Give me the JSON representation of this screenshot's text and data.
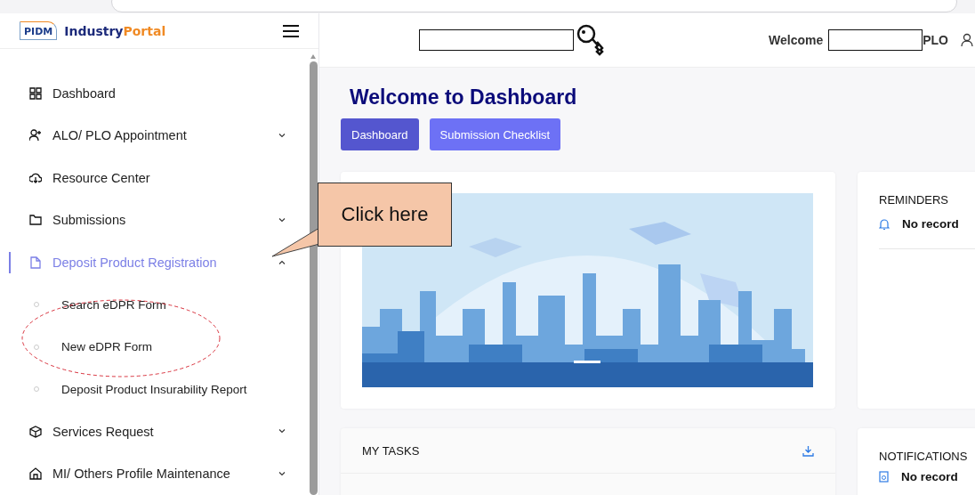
{
  "header": {
    "logo_mark": "PIDM",
    "logo_name_first": "Industry",
    "logo_name_second": "Portal",
    "welcome": "Welcome",
    "role": "PLO"
  },
  "sidebar": {
    "items": [
      {
        "kind": "grid",
        "label": "Dashboard",
        "selected": false
      },
      {
        "kind": "person-add",
        "label": "ALO/ PLO Appointment",
        "selected": false,
        "expanded": false
      },
      {
        "kind": "cloud",
        "label": "Resource Center",
        "selected": false
      },
      {
        "kind": "folder",
        "label": "Submissions",
        "selected": false,
        "expanded": false
      },
      {
        "kind": "file",
        "label": "Deposit Product Registration",
        "selected": true,
        "expanded": true,
        "children": [
          {
            "label": "Search eDPR Form",
            "selected": false
          },
          {
            "label": "New eDPR Form",
            "selected": false
          },
          {
            "label": "Deposit Product Insurability Report",
            "selected": false
          }
        ]
      },
      {
        "kind": "box",
        "label": "Services Request",
        "selected": false,
        "expanded": false
      },
      {
        "kind": "home",
        "label": "MI/ Others Profile Maintenance",
        "selected": false,
        "expanded": false
      }
    ]
  },
  "main": {
    "title": "Welcome to Dashboard",
    "tabs": [
      {
        "label": "Dashboard",
        "selected": true
      },
      {
        "label": "Submission Checklist",
        "selected": false
      }
    ],
    "reminders": {
      "title": "REMINDERS",
      "text": "No record"
    },
    "my_tasks": {
      "title": "MY TASKS"
    },
    "notifications": {
      "title": "NOTIFICATIONS",
      "text": "No record"
    }
  },
  "annotation": {
    "callout": "Click here"
  }
}
